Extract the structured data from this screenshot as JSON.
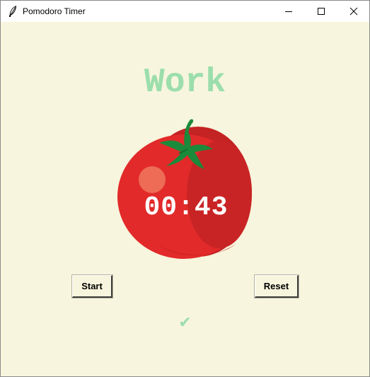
{
  "window": {
    "title": "Pomodoro Timer",
    "icon": "feather-icon",
    "controls": {
      "minimize_icon": "minimize-icon",
      "maximize_icon": "maximize-icon",
      "close_icon": "close-icon"
    }
  },
  "main": {
    "heading": "Work",
    "timer": "00:43",
    "start_label": "Start",
    "reset_label": "Reset",
    "checkmarks": "✔"
  },
  "colors": {
    "background": "#f7f5dd",
    "heading": "#9bdeac",
    "checkmark": "#9bdeac",
    "tomato": "#e22a2a",
    "leaves": "#1b8a3a",
    "timer_text": "#ffffff"
  }
}
